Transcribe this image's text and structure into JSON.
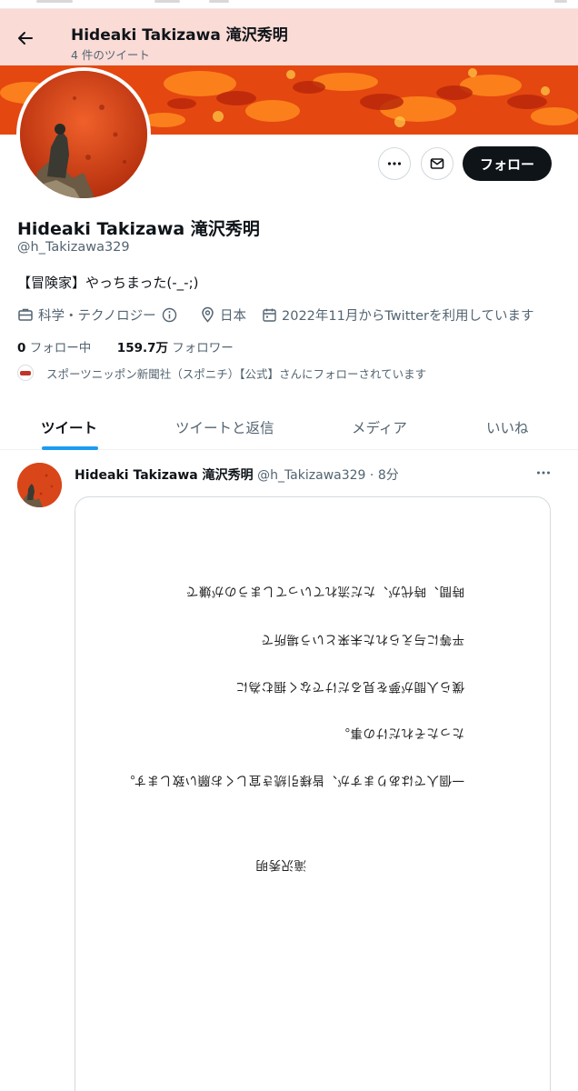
{
  "header": {
    "back_label": "back",
    "title": "Hideaki Takizawa 滝沢秀明",
    "tweet_count": "4 件のツイート"
  },
  "profile": {
    "display_name": "Hideaki Takizawa 滝沢秀明",
    "handle": "@h_Takizawa329",
    "bio": "【冒険家】やっちまった(-_-;)",
    "category": "科学・テクノロジー",
    "location": "日本",
    "joined": "2022年11月からTwitterを利用しています",
    "following_count": "0",
    "following_label": "フォロー中",
    "followers_count": "159.7万",
    "followers_label": "フォロワー",
    "followed_by": "スポーツニッポン新聞社（スポニチ）【公式】さんにフォローされています"
  },
  "actions": {
    "follow_label": "フォロー"
  },
  "tabs": [
    {
      "label": "ツイート",
      "active": true
    },
    {
      "label": "ツイートと返信",
      "active": false
    },
    {
      "label": "メディア",
      "active": false
    },
    {
      "label": "いいね",
      "active": false
    }
  ],
  "tweet": {
    "name": "Hideaki Takizawa 滝沢秀明",
    "handle": "@h_Takizawa329",
    "separator": "·",
    "time": "8分",
    "image_text": {
      "signature": "滝沢秀明",
      "lines": [
        "時間、時代が、ただ流れていってしまうのが嫌で",
        "平等に与えられた未来という場所で",
        "僕ら人間が夢を見るだけでなく掴む為に",
        "たったそれだけの事。",
        "一個人ではありますが、皆様引続き宜しくお願い致します。"
      ]
    }
  },
  "colors": {
    "accent": "#1d9bf0",
    "text_primary": "#0f1419",
    "text_secondary": "#536471",
    "header_bg": "#fad7d2",
    "banner": "#e84a12"
  },
  "icons": [
    "arrow-left-icon",
    "more-icon",
    "mail-icon",
    "briefcase-icon",
    "info-icon",
    "location-pin-icon",
    "calendar-icon"
  ]
}
